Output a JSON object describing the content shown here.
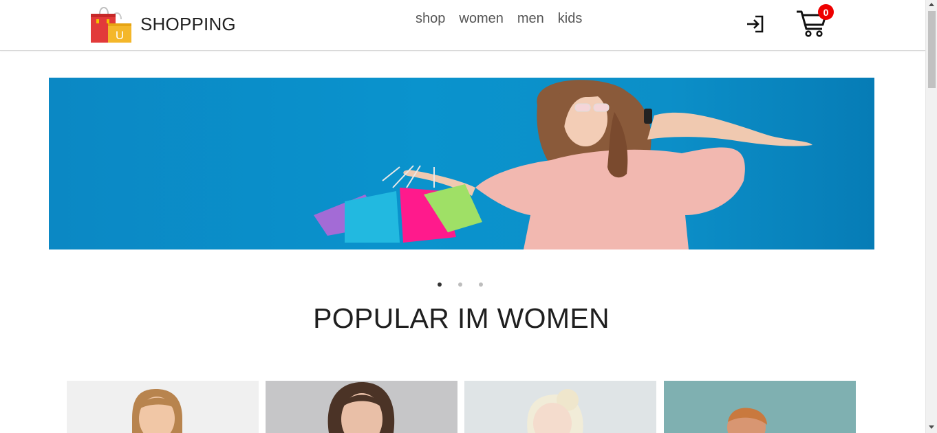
{
  "brand": {
    "name": "SHOPPING",
    "logo_letter": "U",
    "logo_icon": "shopping-bag-icon"
  },
  "nav": {
    "items": [
      {
        "label": "shop"
      },
      {
        "label": "women"
      },
      {
        "label": "men"
      },
      {
        "label": "kids"
      }
    ]
  },
  "header": {
    "login_icon": "login-icon",
    "cart_icon": "cart-icon",
    "cart_count": "0"
  },
  "hero": {
    "slide_count": 3,
    "active_slide": 1,
    "image": "woman-in-pink-dress-with-shopping-bags-on-phone",
    "colors": {
      "background": "#0a93cd",
      "dress": "#f2b8b0"
    }
  },
  "section": {
    "title": "POPULAR IM WOMEN"
  },
  "products": [
    {
      "image": "woman-portrait-light-background",
      "background": "#f0f0f0"
    },
    {
      "image": "woman-portrait-gray-background",
      "background": "#c6c6c8"
    },
    {
      "image": "blonde-woman-portrait-pale-background",
      "background": "#dfe4e6"
    },
    {
      "image": "woman-portrait-teal-background",
      "background": "#7fb0b1"
    }
  ],
  "colors": {
    "badge": "#ee0000",
    "nav_text": "#555555",
    "title_text": "#1f1f1f"
  }
}
